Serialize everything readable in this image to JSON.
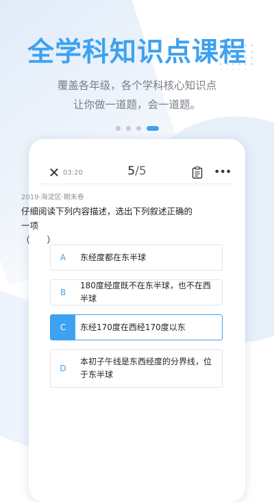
{
  "promo": {
    "headline": "全学科知识点课程",
    "subtitle_line1": "覆盖各年级，各个学科核心知识点",
    "subtitle_line2": "让你做一道题，会一道题。",
    "page_count": 4,
    "active_page": 4,
    "accent_color": "#3ea2f1"
  },
  "quiz": {
    "timer": "03:20",
    "progress_current": "5",
    "progress_sep": "/",
    "progress_total": "5",
    "icons": [
      "close-icon",
      "answer-sheet-icon",
      "more-icon"
    ],
    "source": "2019·海淀区·期末卷",
    "question_line1": "仔细阅读下列内容描述，选出下列叙述正确的一项",
    "question_line2": "（　　）",
    "options": [
      {
        "letter": "A",
        "text": "东经度都在东半球",
        "selected": false
      },
      {
        "letter": "B",
        "text": "180度经度既不在东半球，也不在西半球",
        "selected": false
      },
      {
        "letter": "C",
        "text": "东经170度在西经170度以东",
        "selected": true
      },
      {
        "letter": "D",
        "text": "本初子午线是东西经度的分界线，位于东半球",
        "selected": false
      }
    ]
  }
}
